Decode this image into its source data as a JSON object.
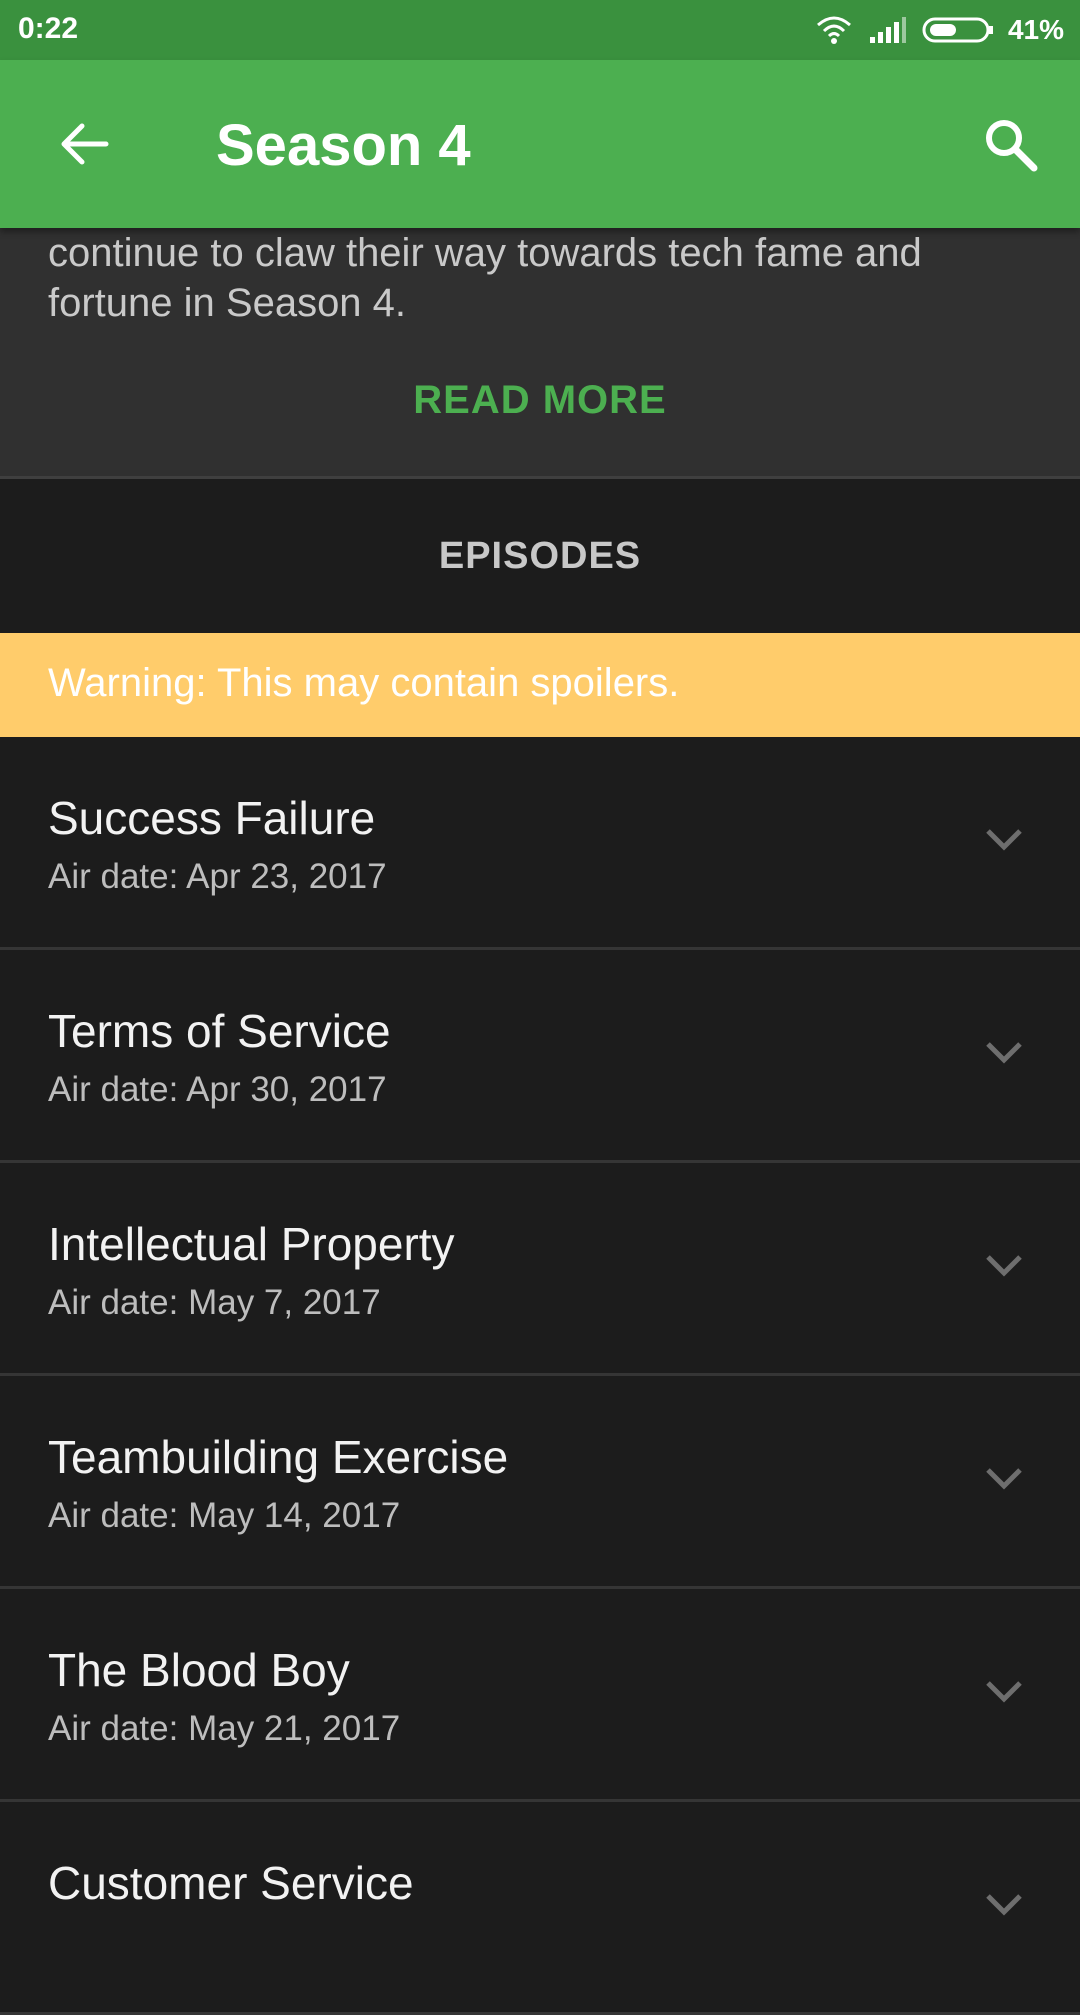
{
  "status_bar": {
    "time": "0:22",
    "battery": "41%"
  },
  "app_bar": {
    "title": "Season 4"
  },
  "description": {
    "text_line1": "continue to claw their way towards tech fame and",
    "text_line2": "fortune in Season 4.",
    "read_more": "READ MORE"
  },
  "episodes": {
    "header": "EPISODES",
    "warning": "Warning: This may contain spoilers.",
    "items": [
      {
        "title": "Success Failure",
        "air_date": "Air date: Apr 23, 2017"
      },
      {
        "title": "Terms of Service",
        "air_date": "Air date: Apr 30, 2017"
      },
      {
        "title": "Intellectual Property",
        "air_date": "Air date: May 7, 2017"
      },
      {
        "title": "Teambuilding Exercise",
        "air_date": "Air date: May 14, 2017"
      },
      {
        "title": "The Blood Boy",
        "air_date": "Air date: May 21, 2017"
      },
      {
        "title": "Customer Service",
        "air_date": ""
      }
    ]
  },
  "colors": {
    "accent": "#4caf50",
    "status_bar": "#3a913e",
    "warning": "#ffcc6b",
    "background": "#1c1c1c"
  }
}
